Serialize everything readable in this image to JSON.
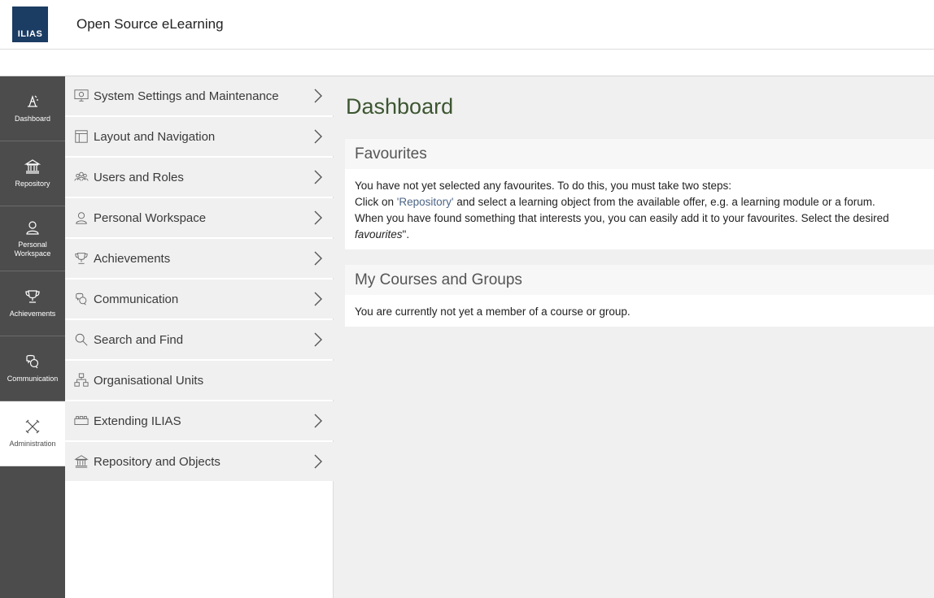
{
  "header": {
    "logo_text": "ILIAS",
    "site_title": "Open Source eLearning"
  },
  "mainbar": {
    "items": [
      {
        "label": "Dashboard",
        "icon": "dashboard-icon"
      },
      {
        "label": "Repository",
        "icon": "repository-icon"
      },
      {
        "label": "Personal Workspace",
        "icon": "person-icon"
      },
      {
        "label": "Achievements",
        "icon": "trophy-icon"
      },
      {
        "label": "Communication",
        "icon": "chat-bubbles-icon"
      },
      {
        "label": "Administration",
        "icon": "tools-icon",
        "active": true
      }
    ]
  },
  "slate": {
    "items": [
      {
        "label": "System Settings and Maintenance",
        "icon": "settings-monitor-icon",
        "has_submenu": true
      },
      {
        "label": "Layout and Navigation",
        "icon": "layout-icon",
        "has_submenu": true
      },
      {
        "label": "Users and Roles",
        "icon": "users-icon",
        "has_submenu": true
      },
      {
        "label": "Personal Workspace",
        "icon": "person-icon",
        "has_submenu": true
      },
      {
        "label": "Achievements",
        "icon": "trophy-icon",
        "has_submenu": true
      },
      {
        "label": "Communication",
        "icon": "chat-bubbles-icon",
        "has_submenu": true
      },
      {
        "label": "Search and Find",
        "icon": "search-icon",
        "has_submenu": true
      },
      {
        "label": "Organisational Units",
        "icon": "org-units-icon",
        "has_submenu": false
      },
      {
        "label": "Extending ILIAS",
        "icon": "plugin-icon",
        "has_submenu": true
      },
      {
        "label": "Repository and Objects",
        "icon": "repository-icon",
        "has_submenu": true
      }
    ]
  },
  "content": {
    "page_title": "Dashboard",
    "favourites": {
      "title": "Favourites",
      "line1": "You have not yet selected any favourites. To do this, you must take two steps:",
      "line2_pre": "Click on ",
      "line2_link": "'Repository'",
      "line2_post": " and select a learning object from the available offer, e.g. a learning module or a forum.",
      "line3": "When you have found something that interests you, you can easily add it to your favourites. Select the desired",
      "line4_em": "favourites",
      "line4_post": "\"."
    },
    "courses": {
      "title": "My Courses and Groups",
      "text": "You are currently not yet a member of a course or group."
    }
  },
  "colors": {
    "mainbar_bg": "#4c4c4c",
    "slate_item_bg": "#f0f0f0",
    "content_bg": "#f0f0f0",
    "title_green": "#3c5631",
    "logo_blue": "#1b3c63",
    "link_blue": "#4c6586"
  }
}
